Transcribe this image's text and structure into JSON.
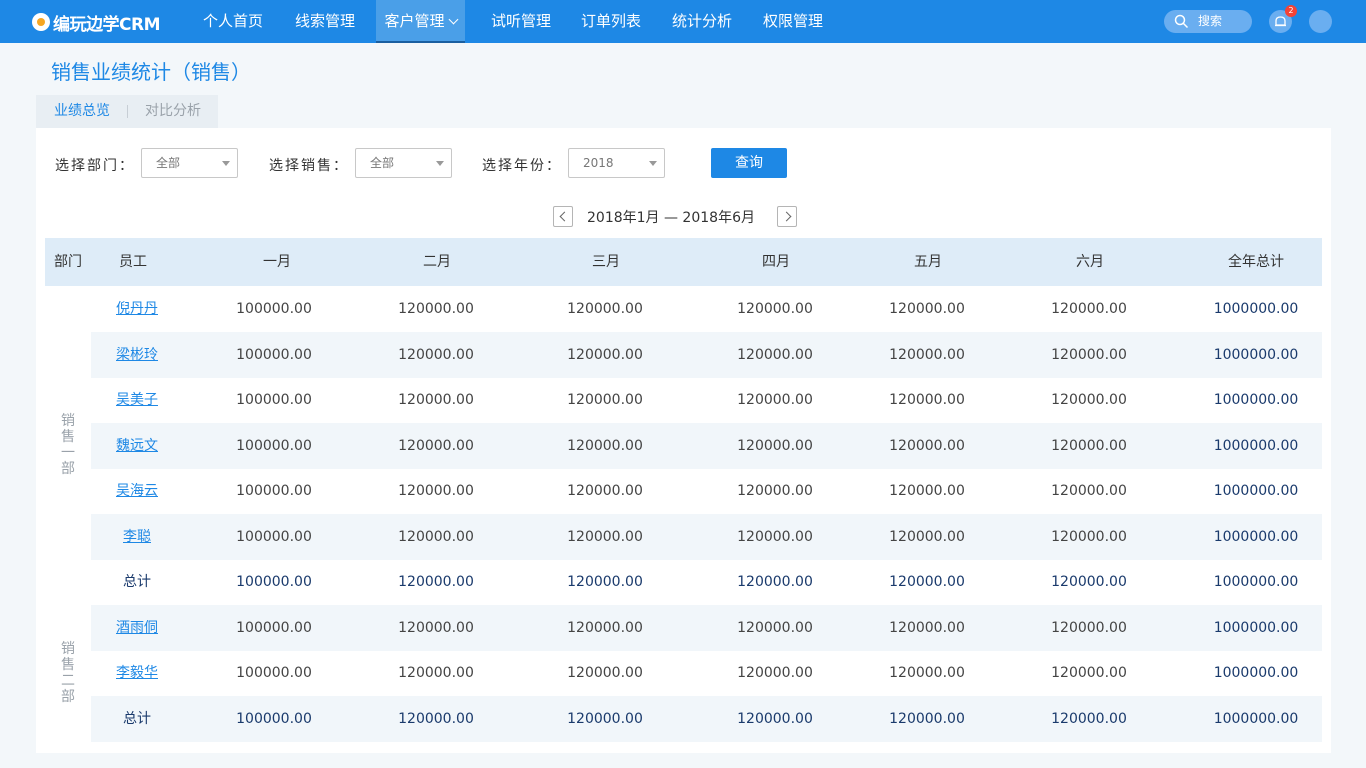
{
  "app": {
    "logo": "编玩边学CRM",
    "title": "销售业绩统计（销售）"
  },
  "nav": {
    "items": [
      "个人首页",
      "线索管理",
      "客户管理",
      "试听管理",
      "订单列表",
      "统计分析",
      "权限管理"
    ],
    "active": "客户管理",
    "search_label": "搜索",
    "notification_count": "2"
  },
  "tabs": [
    "业绩总览",
    "对比分析"
  ],
  "filters": {
    "department_label": "选择部门：",
    "department_value": "全部",
    "sales_label": "选择销售：",
    "sales_value": "全部",
    "year_label": "选择年份：",
    "year_value": "2018",
    "query_button": "查询"
  },
  "period": "2018年1月 — 2018年6月",
  "table": {
    "headers": [
      "部门",
      "员工",
      "一月",
      "二月",
      "三月",
      "四月",
      "五月",
      "六月",
      "全年总计"
    ],
    "groups": [
      {
        "department": "销售一部",
        "rows": [
          {
            "name": "倪丹丹",
            "values": [
              "100000.00",
              "120000.00",
              "120000.00",
              "120000.00",
              "120000.00",
              "120000.00"
            ],
            "total": "1000000.00"
          },
          {
            "name": "梁彬玲",
            "values": [
              "100000.00",
              "120000.00",
              "120000.00",
              "120000.00",
              "120000.00",
              "120000.00"
            ],
            "total": "1000000.00"
          },
          {
            "name": "吴美子",
            "values": [
              "100000.00",
              "120000.00",
              "120000.00",
              "120000.00",
              "120000.00",
              "120000.00"
            ],
            "total": "1000000.00"
          },
          {
            "name": "魏远文",
            "values": [
              "100000.00",
              "120000.00",
              "120000.00",
              "120000.00",
              "120000.00",
              "120000.00"
            ],
            "total": "1000000.00"
          },
          {
            "name": "吴海云",
            "values": [
              "100000.00",
              "120000.00",
              "120000.00",
              "120000.00",
              "120000.00",
              "120000.00"
            ],
            "total": "1000000.00"
          },
          {
            "name": "李聪",
            "values": [
              "100000.00",
              "120000.00",
              "120000.00",
              "120000.00",
              "120000.00",
              "120000.00"
            ],
            "total": "1000000.00"
          }
        ],
        "sum": {
          "label": "总计",
          "values": [
            "100000.00",
            "120000.00",
            "120000.00",
            "120000.00",
            "120000.00",
            "120000.00"
          ],
          "total": "1000000.00"
        }
      },
      {
        "department": "销售二部",
        "rows": [
          {
            "name": "酒雨侗",
            "values": [
              "100000.00",
              "120000.00",
              "120000.00",
              "120000.00",
              "120000.00",
              "120000.00"
            ],
            "total": "1000000.00"
          },
          {
            "name": "李毅华",
            "values": [
              "100000.00",
              "120000.00",
              "120000.00",
              "120000.00",
              "120000.00",
              "120000.00"
            ],
            "total": "1000000.00"
          }
        ],
        "sum": {
          "label": "总计",
          "values": [
            "100000.00",
            "120000.00",
            "120000.00",
            "120000.00",
            "120000.00",
            "120000.00"
          ],
          "total": "1000000.00"
        }
      }
    ]
  }
}
